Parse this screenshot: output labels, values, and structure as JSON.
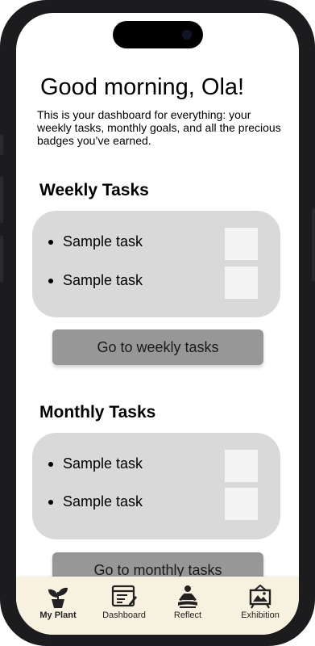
{
  "greeting": "Good morning, Ola!",
  "intro": "This is your dashboard for everything: your weekly tasks, monthly goals, and all the precious badges you’ve earned.",
  "weekly": {
    "title": "Weekly Tasks",
    "tasks": [
      {
        "label": "Sample task"
      },
      {
        "label": "Sample task"
      }
    ],
    "button_label": "Go to weekly tasks"
  },
  "monthly": {
    "title": "Monthly Tasks",
    "tasks": [
      {
        "label": "Sample task"
      },
      {
        "label": "Sample task"
      }
    ],
    "button_label": "Go to monthly tasks"
  },
  "tabbar": {
    "items": [
      {
        "label": "My Plant",
        "icon": "plant-icon",
        "active": true
      },
      {
        "label": "Dashboard",
        "icon": "dashboard-icon",
        "active": false
      },
      {
        "label": "Reflect",
        "icon": "meditation-icon",
        "active": false
      },
      {
        "label": "Exhibition",
        "icon": "gallery-icon",
        "active": false
      }
    ]
  },
  "colors": {
    "card": "#d9d9d9",
    "button": "#979797",
    "tabbar": "#f7f2df",
    "checkbox": "#f4f4f4"
  }
}
